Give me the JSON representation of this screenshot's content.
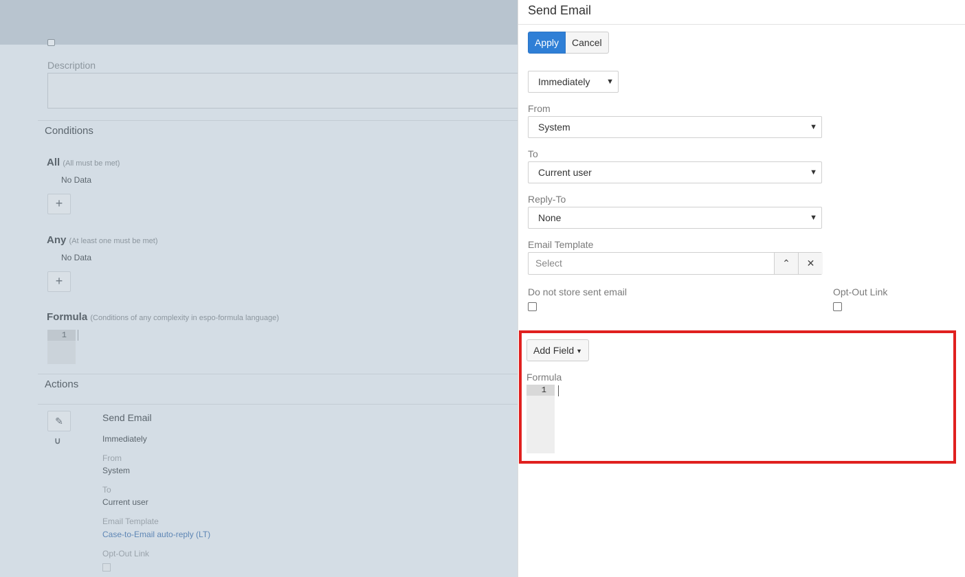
{
  "background": {
    "description_label": "Description",
    "conditions": {
      "title": "Conditions",
      "all": {
        "label": "All",
        "hint": "(All must be met)",
        "empty": "No Data",
        "add": "+"
      },
      "any": {
        "label": "Any",
        "hint": "(At least one must be met)",
        "empty": "No Data",
        "add": "+"
      },
      "formula": {
        "label": "Formula",
        "hint": "(Conditions of any complexity in espo-formula language)",
        "line": "1"
      }
    },
    "actions": {
      "title": "Actions",
      "item": {
        "title": "Send Email",
        "when": "Immediately",
        "from_label": "From",
        "from_value": "System",
        "to_label": "To",
        "to_value": "Current user",
        "template_label": "Email Template",
        "template_value": "Case-to-Email auto-reply (LT)",
        "optout_label": "Opt-Out Link"
      }
    }
  },
  "panel": {
    "title": "Send Email",
    "apply_label": "Apply",
    "cancel_label": "Cancel",
    "execution_time": "Immediately",
    "from": {
      "label": "From",
      "value": "System"
    },
    "to": {
      "label": "To",
      "value": "Current user"
    },
    "reply_to": {
      "label": "Reply-To",
      "value": "None"
    },
    "email_template": {
      "label": "Email Template",
      "placeholder": "Select"
    },
    "do_not_store": {
      "label": "Do not store sent email",
      "checked": false
    },
    "opt_out": {
      "label": "Opt-Out Link",
      "checked": false
    },
    "add_field_label": "Add Field",
    "formula": {
      "label": "Formula",
      "line": "1"
    },
    "highlight_color": "#e0201f",
    "accent_color": "#2f7fd6"
  }
}
